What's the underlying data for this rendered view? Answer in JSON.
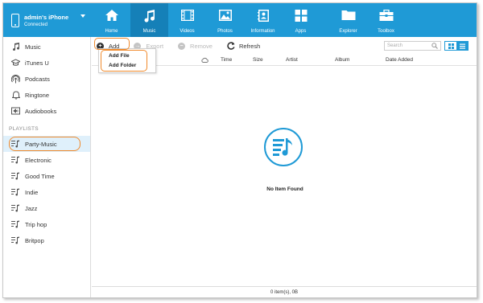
{
  "device": {
    "name": "admin's iPhone",
    "status": "Connected"
  },
  "nav": [
    {
      "label": "Home",
      "icon": "home-icon"
    },
    {
      "label": "Music",
      "icon": "music-note-icon",
      "active": true
    },
    {
      "label": "Videos",
      "icon": "film-icon"
    },
    {
      "label": "Photos",
      "icon": "image-icon"
    },
    {
      "label": "Information",
      "icon": "contacts-icon"
    },
    {
      "label": "Apps",
      "icon": "apps-grid-icon"
    },
    {
      "label": "Explorer",
      "icon": "folder-icon"
    },
    {
      "label": "Toolbox",
      "icon": "toolbox-icon"
    }
  ],
  "sidebar": {
    "library": [
      {
        "label": "Music",
        "icon": "music-note-icon"
      },
      {
        "label": "iTunes U",
        "icon": "graduation-cap-icon"
      },
      {
        "label": "Podcasts",
        "icon": "podcast-icon"
      },
      {
        "label": "Ringtone",
        "icon": "bell-icon"
      },
      {
        "label": "Audiobooks",
        "icon": "audiobook-icon"
      }
    ],
    "playlists_heading": "PLAYLISTS",
    "playlists": [
      {
        "label": "Party-Music",
        "selected": true
      },
      {
        "label": "Electronic"
      },
      {
        "label": "Good Time"
      },
      {
        "label": "Indie"
      },
      {
        "label": "Jazz"
      },
      {
        "label": "Trip hop"
      },
      {
        "label": "Britpop"
      }
    ]
  },
  "toolbar": {
    "add": "Add",
    "export": "Export",
    "remove": "Remove",
    "refresh": "Refresh",
    "search_placeholder": "Search"
  },
  "add_menu": {
    "items": [
      "Add File",
      "Add Folder"
    ]
  },
  "columns": [
    "Time",
    "Size",
    "Artist",
    "Album",
    "Date Added"
  ],
  "empty_state": "No Item Found",
  "status_bar": "0 item(s), 0B",
  "colors": {
    "accent": "#1f9ad6",
    "accent_dark": "#1580b8",
    "highlight": "#f08a2c"
  }
}
